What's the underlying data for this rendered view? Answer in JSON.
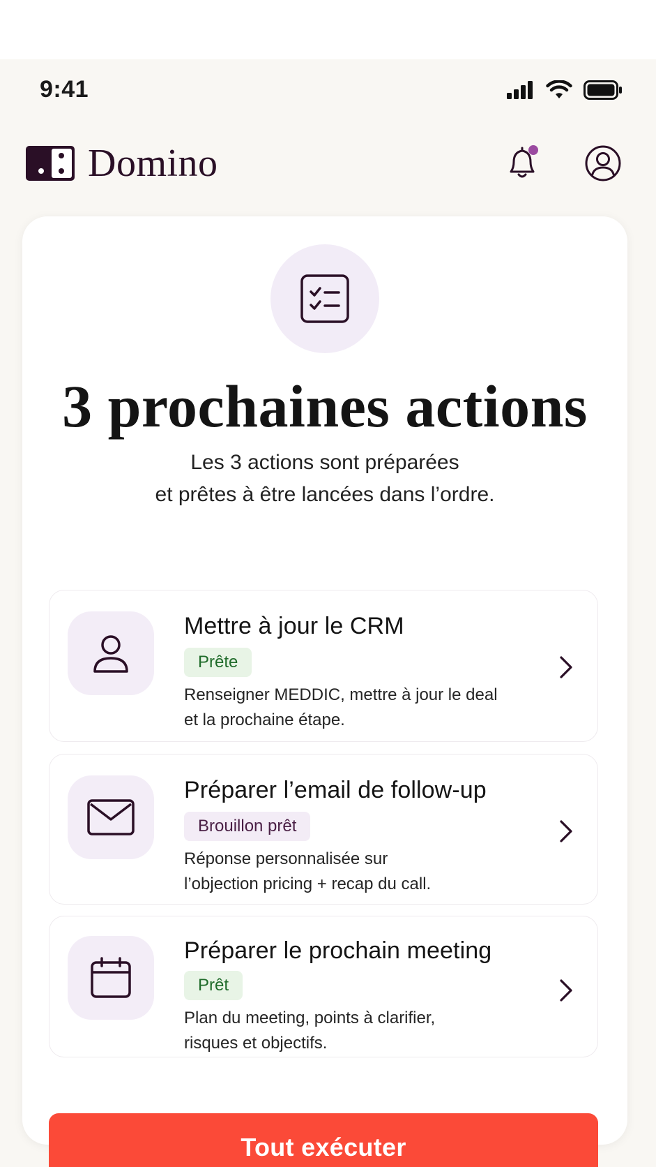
{
  "status_bar": {
    "time": "9:41",
    "icons": [
      "cellular-signal-icon",
      "wifi-icon",
      "battery-icon"
    ]
  },
  "header": {
    "app_name": "Domino",
    "logo_icon": "domino-tile-icon",
    "notification_icon": "bell-icon",
    "notification_dot": true,
    "account_icon": "user-circle-icon"
  },
  "hero": {
    "icon": "checklist-icon",
    "title": "3 prochaines actions",
    "subtitle_line_1": "Les 3 actions sont préparées",
    "subtitle_line_2": "et prêtes à être lancées dans l’ordre."
  },
  "actions": [
    {
      "icon": "user-icon",
      "title": "Mettre à jour le CRM",
      "badge": "Prête",
      "badge_style": "green",
      "desc_line_1": "Renseigner MEDDIC, mettre à jour le deal",
      "desc_line_2": "et la prochaine étape."
    },
    {
      "icon": "mail-icon",
      "title": "Préparer l’email de follow-up",
      "badge": "Brouillon prêt",
      "badge_style": "purple",
      "desc_line_1": "Réponse personnalisée sur",
      "desc_line_2": "l’objection pricing + recap du call."
    },
    {
      "icon": "calendar-icon",
      "title": "Préparer le prochain meeting",
      "badge": "Prêt",
      "badge_style": "green",
      "desc_line_1": "Plan du meeting, points à clarifier,",
      "desc_line_2": "risques et objectifs."
    }
  ],
  "cta": {
    "label": "Tout exécuter"
  },
  "colors": {
    "brand": "#2a0f26",
    "accent_notification": "#9b4aa0",
    "cta": "#fb4a38",
    "badge_green_bg": "#e8f4e6",
    "badge_green_text": "#1f6b2a",
    "badge_purple_bg": "#f3ecf6",
    "badge_purple_text": "#4a1f45",
    "icon_tile_bg": "#f3edf7"
  }
}
